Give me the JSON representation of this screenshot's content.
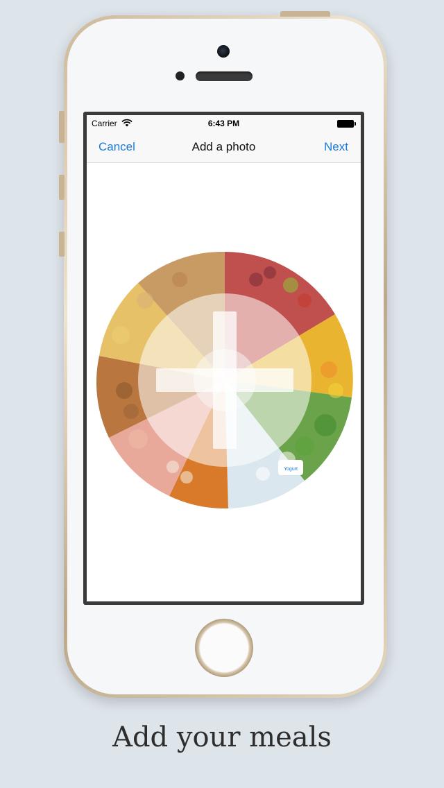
{
  "status_bar": {
    "carrier": "Carrier",
    "time": "6:43 PM",
    "icons": [
      "wifi-icon",
      "battery-icon"
    ]
  },
  "nav": {
    "cancel_label": "Cancel",
    "title": "Add a photo",
    "next_label": "Next"
  },
  "photo": {
    "subject": "food-wheel",
    "icon": "add-photo-plus-icon",
    "labels": [
      "Yogurt"
    ]
  },
  "caption": "Add your meals",
  "colors": {
    "accent": "#1a7bd6",
    "background": "#dde4ea",
    "caption": "#2d2d2d"
  }
}
